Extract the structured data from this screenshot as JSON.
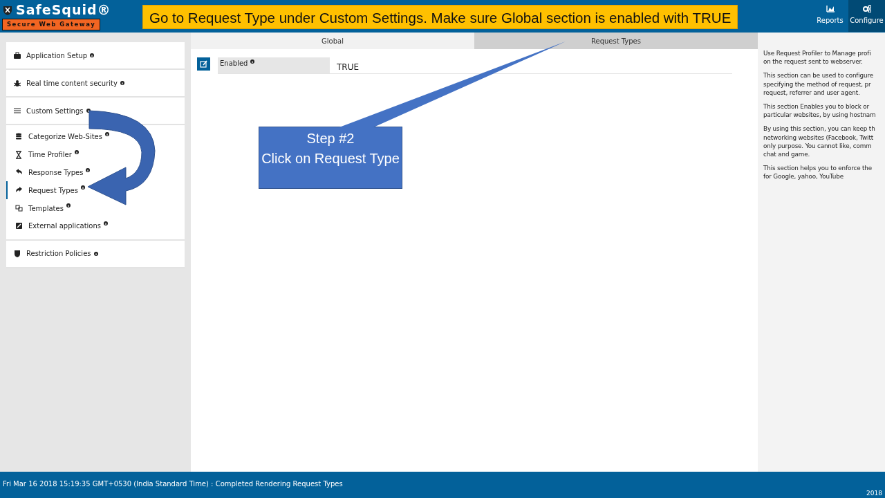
{
  "header": {
    "logo_title": "SafeSquid®",
    "logo_subtitle": "Secure Web Gateway",
    "banner": "Go to Request Type under Custom Settings. Make sure Global section is enabled with TRUE",
    "nav": [
      {
        "label": "Reports",
        "selected": false
      },
      {
        "label": "Configure",
        "selected": true
      }
    ]
  },
  "sidebar": {
    "sections": [
      {
        "label": "Application Setup"
      },
      {
        "label": "Real time content security"
      },
      {
        "label": "Custom Settings",
        "children": [
          {
            "label": "Categorize Web-Sites",
            "selected": false
          },
          {
            "label": "Time Profiler",
            "selected": false
          },
          {
            "label": "Response Types",
            "selected": false
          },
          {
            "label": "Request Types",
            "selected": true
          },
          {
            "label": "Templates",
            "selected": false
          },
          {
            "label": "External applications",
            "selected": false
          }
        ]
      },
      {
        "label": "Restriction Policies"
      }
    ]
  },
  "tabs": [
    {
      "label": "Global",
      "selected": true
    },
    {
      "label": "Request Types",
      "selected": false
    }
  ],
  "fields": [
    {
      "label": "Enabled",
      "value": "TRUE"
    }
  ],
  "callout": {
    "lines": [
      "Step #2",
      "Click on Request Type"
    ]
  },
  "help_panel": {
    "paragraphs": [
      [
        "Use Request Profiler to Manage profi",
        "on the request sent to webserver."
      ],
      [
        "This section can be used to configure",
        "specifying the method of request, pr",
        "request, referrer and user agent."
      ],
      [
        "This section Enables you to block or",
        "particular websites, by using hostnam"
      ],
      [
        "By using this section, you can keep th",
        "networking websites (Facebook, Twitt",
        "only purpose. You cannot like, comm",
        "chat and game."
      ],
      [
        "This section helps you to enforce the",
        "for Google, yahoo, YouTube"
      ]
    ]
  },
  "status_bar": {
    "message": "Fri Mar 16 2018 15:19:35 GMT+0530 (India Standard Time) : Completed Rendering Request Types",
    "year": "2018"
  }
}
